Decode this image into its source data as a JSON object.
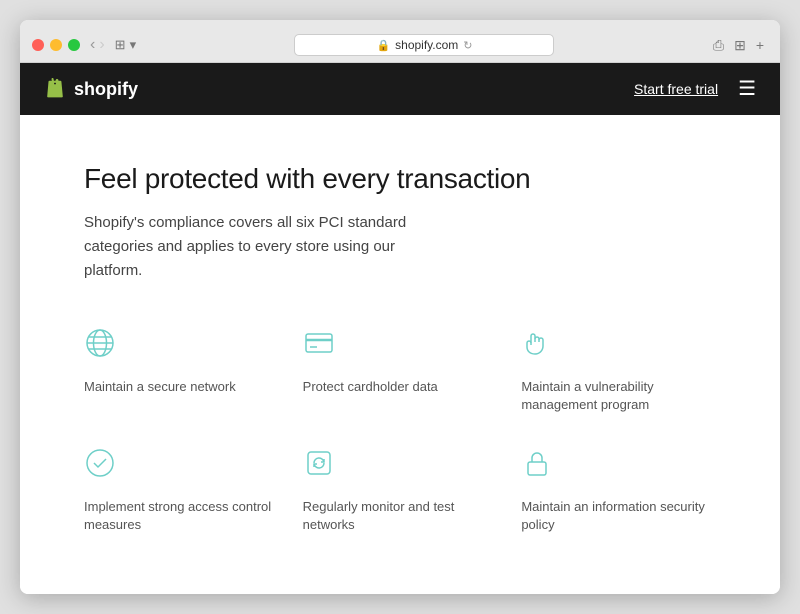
{
  "browser": {
    "url": "shopify.com",
    "tab_label": "shopify.com"
  },
  "nav": {
    "logo_text": "shopify",
    "cta_label": "Start free trial",
    "hamburger_label": "☰"
  },
  "hero": {
    "title": "Feel protected with every transaction",
    "description": "Shopify's compliance covers all six PCI standard categories and applies to every store using our platform."
  },
  "features": [
    {
      "id": "secure-network",
      "icon": "globe",
      "label": "Maintain a secure network"
    },
    {
      "id": "cardholder-data",
      "icon": "card",
      "label": "Protect cardholder data"
    },
    {
      "id": "vulnerability",
      "icon": "hand",
      "label": "Maintain a vulnerability management program"
    },
    {
      "id": "access-control",
      "icon": "checkmark",
      "label": "Implement strong access control measures"
    },
    {
      "id": "monitor-test",
      "icon": "refresh-shield",
      "label": "Regularly monitor and test networks"
    },
    {
      "id": "security-policy",
      "icon": "lock",
      "label": "Maintain an information security policy"
    }
  ]
}
